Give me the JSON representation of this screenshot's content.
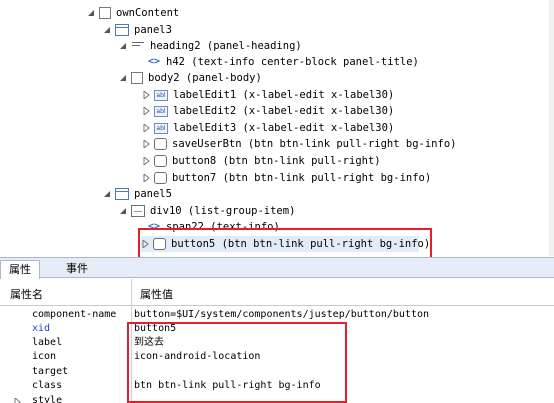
{
  "tree": {
    "nodes": [
      {
        "label": "ownContent",
        "icon": "checkbox-icon"
      },
      {
        "label": "panel3",
        "icon": "panel-icon"
      },
      {
        "label": "heading2 (panel-heading)",
        "icon": "heading-icon"
      },
      {
        "label": "h42 (text-info center-block panel-title)",
        "icon": "code-icon"
      },
      {
        "label": "body2 (panel-body)",
        "icon": "checkbox-icon"
      },
      {
        "label": "labelEdit1 (x-label-edit x-label30)",
        "icon": "label-edit-icon"
      },
      {
        "label": "labelEdit2 (x-label-edit x-label30)",
        "icon": "label-edit-icon"
      },
      {
        "label": "labelEdit3 (x-label-edit x-label30)",
        "icon": "label-edit-icon"
      },
      {
        "label": "saveUserBtn (btn btn-link pull-right bg-info)",
        "icon": "button-icon"
      },
      {
        "label": "button8 (btn btn-link pull-right)",
        "icon": "button-icon"
      },
      {
        "label": "button7 (btn btn-link pull-right bg-info)",
        "icon": "button-icon"
      },
      {
        "label": "panel5",
        "icon": "panel-icon"
      },
      {
        "label": "div10 (list-group-item)",
        "icon": "div-icon"
      },
      {
        "label": "span22 (text-info)",
        "icon": "code-icon"
      },
      {
        "label": "button5 (btn btn-link pull-right bg-info)",
        "icon": "button-icon"
      }
    ],
    "icon_label": "abl"
  },
  "tabs": [
    {
      "label": "属性"
    },
    {
      "label": "事件"
    }
  ],
  "properties": {
    "header_name": "属性名",
    "header_value": "属性值",
    "rows": [
      {
        "name": "component-name",
        "value": "button=$UI/system/components/justep/button/button"
      },
      {
        "name": "xid",
        "value": "button5"
      },
      {
        "name": "label",
        "value": "到这去"
      },
      {
        "name": "icon",
        "value": "icon-android-location"
      },
      {
        "name": "target",
        "value": ""
      },
      {
        "name": "class",
        "value": "btn btn-link pull-right bg-info"
      },
      {
        "name": "style",
        "value": ""
      }
    ]
  },
  "colors": {
    "highlight_border": "#e4202a",
    "xid_text": "#1a3fd8",
    "tab_bar": "#e6ecf5"
  }
}
